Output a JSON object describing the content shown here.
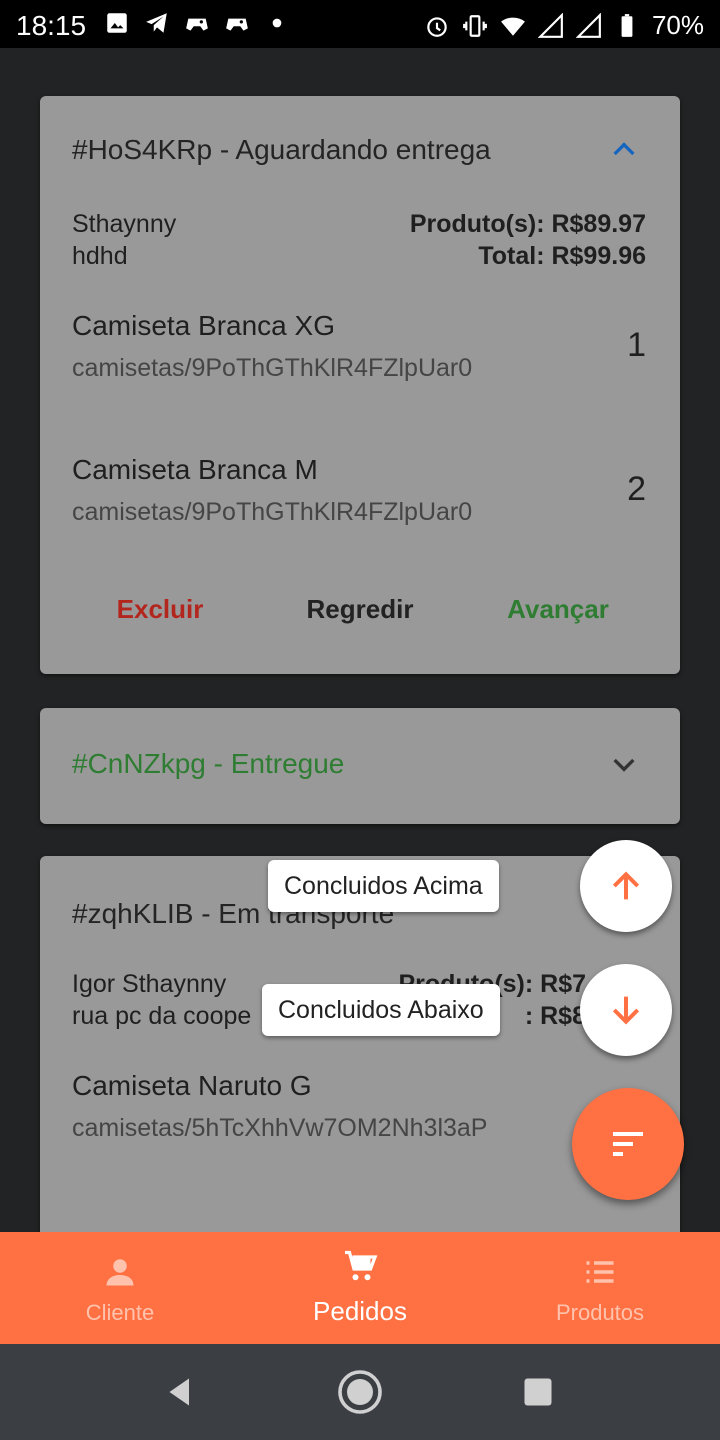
{
  "status_bar": {
    "time": "18:15",
    "battery": "70%",
    "left_icons": [
      "image-icon",
      "telegram-icon",
      "game-controller-icon",
      "game-controller-icon",
      "dot-icon"
    ],
    "right_icons": [
      "alarm-icon",
      "vibrate-icon",
      "wifi-icon",
      "signal-icon",
      "signal-icon",
      "battery-icon"
    ]
  },
  "orders": [
    {
      "title": "#HoS4KRp - Aguardando entrega",
      "expanded": true,
      "customer_name": "Sthaynny",
      "customer_address": "hdhd",
      "products_total": "Produto(s): R$89.97",
      "total": "Total: R$99.96",
      "items": [
        {
          "name": "Camiseta Branca XG",
          "path": "camisetas/9PoThGThKlR4FZlpUar0",
          "qty": "1"
        },
        {
          "name": "Camiseta Branca M",
          "path": "camisetas/9PoThGThKlR4FZlpUar0",
          "qty": "2"
        }
      ],
      "actions": {
        "delete": "Excluir",
        "back": "Regredir",
        "forward": "Avançar"
      }
    },
    {
      "title": "#CnNZkpg - Entregue",
      "expanded": false
    },
    {
      "title": "#zqhKLIB - Em transporte",
      "expanded": true,
      "customer_name": "Igor Sthaynny",
      "customer_address": "rua pc da coope",
      "products_total": "Produto(s): R$7",
      "total": ": R$8",
      "items": [
        {
          "name": "Camiseta Naruto G",
          "path": "camisetas/5hTcXhhVw7OM2Nh3l3aP",
          "qty": ""
        }
      ]
    }
  ],
  "fab": {
    "sort_up_label": "Concluidos Acima",
    "sort_down_label": "Concluidos Abaixo",
    "main_icon": "sort-icon"
  },
  "bottom_nav": {
    "items": [
      {
        "label": "Cliente",
        "icon": "person-icon"
      },
      {
        "label": "Pedidos",
        "icon": "cart-icon"
      },
      {
        "label": "Produtos",
        "icon": "list-icon"
      }
    ],
    "active": "Pedidos"
  },
  "colors": {
    "accent": "#ff7043",
    "card": "#999999",
    "delete": "#b3261e",
    "forward": "#2e7d32",
    "chevron_active": "#1565c0"
  }
}
